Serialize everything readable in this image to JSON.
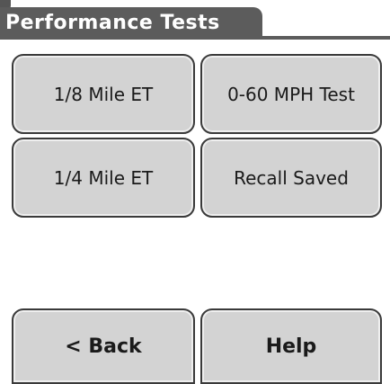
{
  "header": {
    "title": "Performance Tests"
  },
  "menu": {
    "eighth_mile": "1/8 Mile ET",
    "zero_sixty": "0-60 MPH Test",
    "quarter_mile": "1/4 Mile ET",
    "recall_saved": "Recall Saved"
  },
  "footer": {
    "back_label": "< Back",
    "help_label": "Help"
  },
  "colors": {
    "title_bar": "#5c5c5c",
    "button_fill": "#d3d3d3",
    "button_border": "#3a3a3a"
  }
}
